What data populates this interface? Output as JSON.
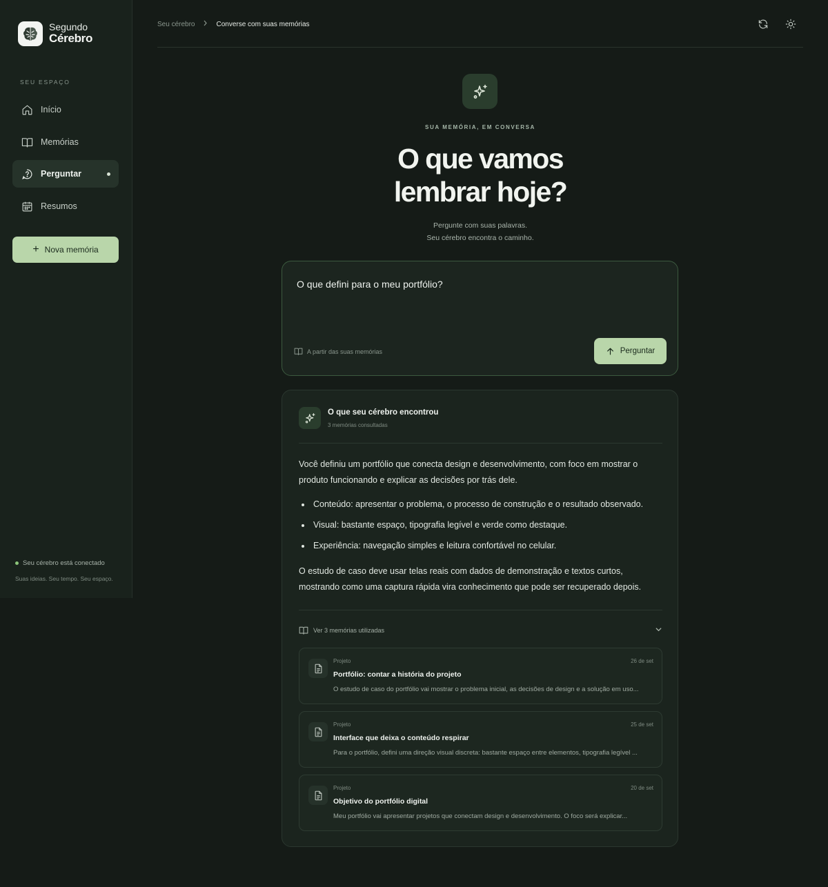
{
  "brand": {
    "line1": "Segundo",
    "line2": "Cérebro",
    "icon": "brain-icon"
  },
  "sidebar": {
    "section_label": "SEU ESPAÇO",
    "items": [
      {
        "label": "Início",
        "icon": "home-icon"
      },
      {
        "label": "Memórias",
        "icon": "book-icon"
      },
      {
        "label": "Perguntar",
        "icon": "question-icon",
        "active": true
      },
      {
        "label": "Resumos",
        "icon": "calendar-icon"
      }
    ],
    "new_button": "Nova memória",
    "status": "Seu cérebro está conectado",
    "tagline": "Suas ideias. Seu tempo. Seu espaço."
  },
  "header": {
    "breadcrumb_root": "Seu cérebro",
    "breadcrumb_current": "Converse com suas memórias",
    "icons": [
      "refresh-icon",
      "sun-icon"
    ]
  },
  "hero": {
    "kicker": "SUA MEMÓRIA, EM CONVERSA",
    "title_line1": "O que vamos",
    "title_line2": "lembrar hoje?",
    "subtitle_line1": "Pergunte com suas palavras.",
    "subtitle_line2": "Seu cérebro encontra o caminho."
  },
  "ask": {
    "value": "O que defini para o meu portfólio?",
    "hint": "A partir das suas memórias",
    "button": "Perguntar"
  },
  "answer": {
    "title": "O que seu cérebro encontrou",
    "count": "3 memórias consultadas",
    "intro": "Você definiu um portfólio que conecta design e desenvolvimento, com foco em mostrar o produto funcionando e explicar as decisões por trás dele.",
    "bullets": [
      "Conteúdo: apresentar o problema, o processo de construção e o resultado observado.",
      "Visual: bastante espaço, tipografia legível e verde como destaque.",
      "Experiência: navegação simples e leitura confortável no celular."
    ],
    "outro": "O estudo de caso deve usar telas reais com dados de demonstração e textos curtos, mostrando como uma captura rápida vira conhecimento que pode ser recuperado depois.",
    "memories_toggle": "Ver 3 memórias utilizadas",
    "memories": [
      {
        "category": "Projeto",
        "date": "26 de set",
        "title": "Portfólio: contar a história do projeto",
        "excerpt": "O estudo de caso do portfólio vai mostrar o problema inicial, as decisões de design e a solução em uso..."
      },
      {
        "category": "Projeto",
        "date": "25 de set",
        "title": "Interface que deixa o conteúdo respirar",
        "excerpt": "Para o portfólio, defini uma direção visual discreta: bastante espaço entre elementos, tipografia legível ..."
      },
      {
        "category": "Projeto",
        "date": "20 de set",
        "title": "Objetivo do portfólio digital",
        "excerpt": "Meu portfólio vai apresentar projetos que conectam design e desenvolvimento. O foco será explicar..."
      }
    ]
  },
  "colors": {
    "accent": "#b9d6aa",
    "background": "#151b17",
    "sidebar": "#19221c",
    "status_dot": "#8cc57a"
  }
}
